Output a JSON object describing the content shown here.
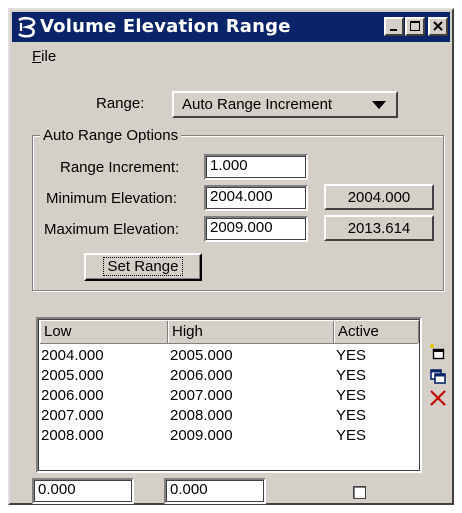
{
  "window": {
    "title": "Volume Elevation Range",
    "buttons": {
      "minimize_icon": "minimize-icon",
      "maximize_icon": "maximize-icon",
      "close_icon": "close-icon"
    }
  },
  "menu": {
    "file_first": "F",
    "file_rest": "ile"
  },
  "range": {
    "label": "Range:",
    "selected": "Auto Range Increment"
  },
  "auto_range": {
    "group_title": "Auto Range Options",
    "increment_label": "Range Increment:",
    "increment_value": "1.000",
    "min_label": "Minimum Elevation:",
    "min_value": "2004.000",
    "min_button": "2004.000",
    "max_label": "Maximum Elevation:",
    "max_value": "2009.000",
    "max_button": "2013.614",
    "set_range_label": "Set Range"
  },
  "table": {
    "columns": [
      "Low",
      "High",
      "Active"
    ],
    "rows": [
      [
        "2004.000",
        "2005.000",
        "YES"
      ],
      [
        "2005.000",
        "2006.000",
        "YES"
      ],
      [
        "2006.000",
        "2007.000",
        "YES"
      ],
      [
        "2007.000",
        "2008.000",
        "YES"
      ],
      [
        "2008.000",
        "2009.000",
        "YES"
      ]
    ]
  },
  "edit_row": {
    "low_value": "0.000",
    "high_value": "0.000",
    "active_checked": false
  },
  "side_icons": [
    "add-row-icon",
    "copy-row-icon",
    "delete-row-icon"
  ],
  "colors": {
    "titlebar": "#0a246a",
    "face": "#d4d0c8",
    "delete": "#c00000"
  }
}
